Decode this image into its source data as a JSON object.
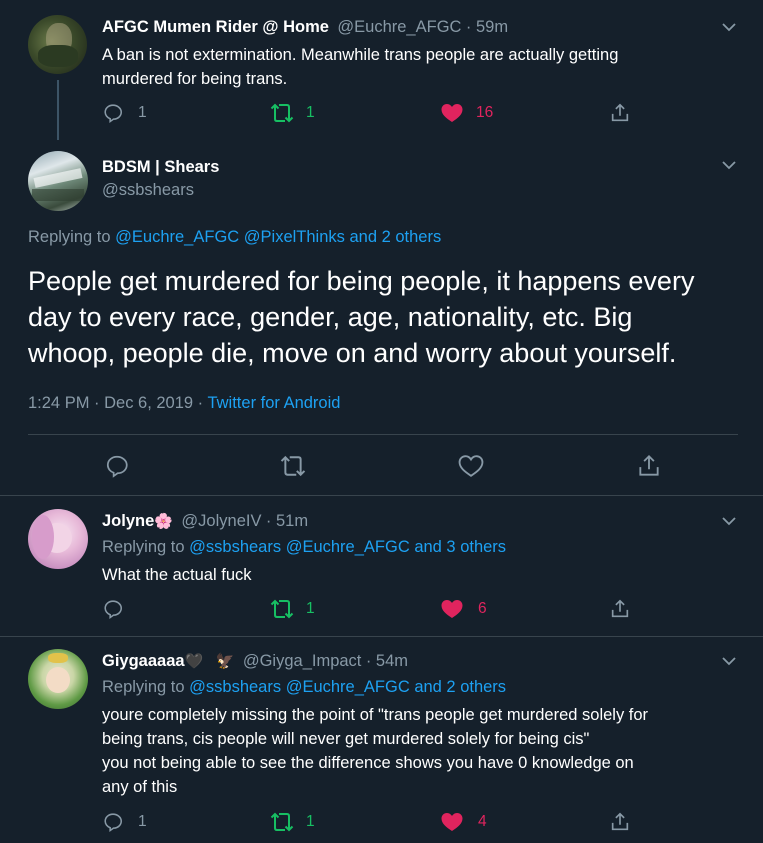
{
  "tweet1": {
    "name": "AFGC Mumen Rider @ Home",
    "handle": "@Euchre_AFGC",
    "time": "· 59m",
    "text_line1": "A ban is not extermination. Meanwhile trans people are actually getting",
    "text_line2": "murdered for being trans.",
    "replies": "1",
    "retweets": "1",
    "likes": "16"
  },
  "main_tweet": {
    "name": "BDSM | Shears",
    "handle": "@ssbshears",
    "replying_prefix": "Replying to",
    "replying_users": "@Euchre_AFGC @PixelThinks and 2 others",
    "text_line1": "People get murdered for being people, it happens every",
    "text_line2": "day to every race, gender, age, nationality, etc. Big",
    "text_line3": "whoop, people die, move on and worry about yourself.",
    "meta_time": "1:24 PM · Dec 6, 2019 ·",
    "source": "Twitter for Android"
  },
  "reply1": {
    "name": "Jolyne",
    "emoji": "🌸",
    "handle": "@JolyneIV",
    "time": "· 51m",
    "replying_prefix": "Replying to",
    "replying_users": "@ssbshears @Euchre_AFGC and 3 others",
    "text": "What the actual fuck",
    "retweets": "1",
    "likes": "6"
  },
  "reply2": {
    "name": "Giygaaaaa",
    "emoji": "🖤",
    "emoji2": "🦅",
    "handle": "@Giyga_Impact",
    "time": "· 54m",
    "replying_prefix": "Replying to",
    "replying_users": "@ssbshears @Euchre_AFGC and 2 others",
    "text_line1": "youre completely missing the point of \"trans people get murdered solely for",
    "text_line2": "being trans, cis people will never get murdered solely for being cis\"",
    "text_line3": "you not being able to see the difference shows you have 0 knowledge on",
    "text_line4": "any of this",
    "replies": "1",
    "retweets": "1",
    "likes": "4"
  },
  "colors": {
    "background": "#15202b",
    "secondary_text": "#8899a6",
    "link": "#1da1f2",
    "retweet": "#17bf63",
    "like": "#e0245e",
    "divider": "#38444d"
  }
}
